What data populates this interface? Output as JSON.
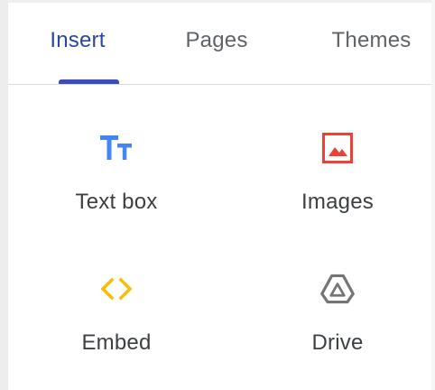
{
  "tabs": [
    {
      "label": "Insert",
      "active": true
    },
    {
      "label": "Pages",
      "active": false
    },
    {
      "label": "Themes",
      "active": false
    }
  ],
  "insert_items": [
    {
      "label": "Text box",
      "icon": "text-box-icon",
      "color": "#4285f4"
    },
    {
      "label": "Images",
      "icon": "image-icon",
      "color": "#ea4335"
    },
    {
      "label": "Embed",
      "icon": "embed-code-icon",
      "color": "#fbbc04"
    },
    {
      "label": "Drive",
      "icon": "google-drive-icon",
      "color": "#757575"
    }
  ],
  "colors": {
    "active_tab": "#2946a6",
    "indicator": "#3b4fbc",
    "inactive_tab": "#5f6368"
  }
}
